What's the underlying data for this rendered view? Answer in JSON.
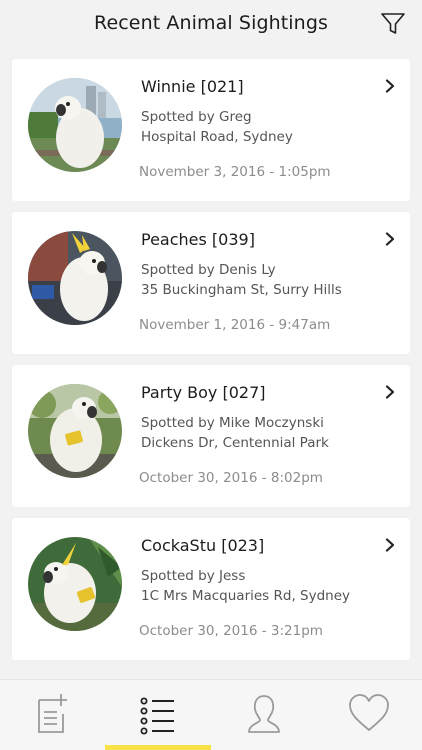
{
  "header": {
    "title": "Recent Animal Sightings",
    "filter_icon": "filter-icon"
  },
  "sightings": [
    {
      "name": "Winnie [021]",
      "spotted_by": "Spotted by Greg",
      "location": "Hospital Road, Sydney",
      "datetime": "November 3, 2016 - 1:05pm"
    },
    {
      "name": "Peaches [039]",
      "spotted_by": "Spotted by Denis Ly",
      "location": "35 Buckingham St, Surry Hills",
      "datetime": "November 1, 2016 - 9:47am"
    },
    {
      "name": "Party Boy [027]",
      "spotted_by": "Spotted by Mike Moczynski",
      "location": "Dickens Dr, Centennial Park",
      "datetime": "October 30, 2016 - 8:02pm"
    },
    {
      "name": "CockaStu [023]",
      "spotted_by": "Spotted by Jess",
      "location": "1C Mrs Macquaries Rd, Sydney",
      "datetime": "October 30, 2016 - 3:21pm"
    }
  ],
  "tabbar": {
    "tabs": [
      {
        "icon": "new-report-icon",
        "active": false
      },
      {
        "icon": "list-icon",
        "active": true
      },
      {
        "icon": "profile-icon",
        "active": false
      },
      {
        "icon": "heart-icon",
        "active": false
      }
    ],
    "indicator_color": "#f7e24a"
  }
}
